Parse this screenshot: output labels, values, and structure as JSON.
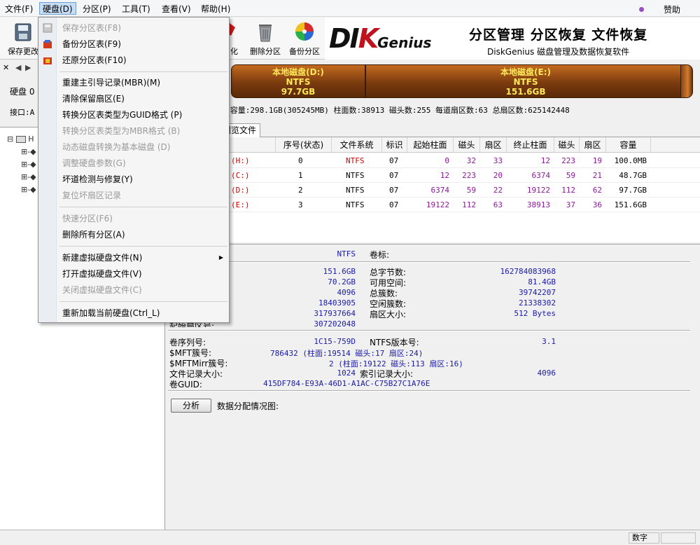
{
  "menubar": {
    "items": [
      "文件(F)",
      "硬盘(D)",
      "分区(P)",
      "工具(T)",
      "查看(V)",
      "帮助(H)"
    ],
    "sponsor": "赞助"
  },
  "toolbar": {
    "save_label": "保存更改",
    "format_label": "化",
    "delete_label": "删除分区",
    "backup_label": "备份分区"
  },
  "banner": {
    "logo_pre": "DI",
    "logo_k": "K",
    "logo_gen": "Genius",
    "tagline": "分区管理 分区恢复 文件恢复",
    "subline": "DiskGenius 磁盘管理及数据恢复软件"
  },
  "left": {
    "disk_label": "硬盘 0",
    "iface_label": "接口:A",
    "tree_root": "H"
  },
  "diskmap": {
    "d": {
      "name": "本地磁盘(D:)",
      "fs": "NTFS",
      "size": "97.7GB"
    },
    "e": {
      "name": "本地磁盘(E:)",
      "fs": "NTFS",
      "size": "151.6GB"
    }
  },
  "infoline": "PCN40Y1YFBBS6  容量:298.1GB(305245MB)  柱面数:38913  磁头数:255  每道扇区数:63  总扇区数:625142448",
  "tabs": {
    "browse": "浏览文件"
  },
  "table": {
    "headers": [
      "序号(状态)",
      "文件系统",
      "标识",
      "起始柱面",
      "磁头",
      "扇区",
      "终止柱面",
      "磁头",
      "扇区",
      "容量"
    ],
    "rows": [
      {
        "vol": "(H:)",
        "idx": "0",
        "fs": "NTFS",
        "id": "07",
        "sc": "0",
        "sh": "32",
        "ss": "33",
        "ec": "12",
        "eh": "223",
        "es": "19",
        "cap": "100.0MB"
      },
      {
        "vol": "(C:)",
        "idx": "1",
        "fs": "NTFS",
        "id": "07",
        "sc": "12",
        "sh": "223",
        "ss": "20",
        "ec": "6374",
        "eh": "59",
        "es": "21",
        "cap": "48.7GB"
      },
      {
        "vol": "(D:)",
        "idx": "2",
        "fs": "NTFS",
        "id": "07",
        "sc": "6374",
        "sh": "59",
        "ss": "22",
        "ec": "19122",
        "eh": "112",
        "es": "62",
        "cap": "97.7GB"
      },
      {
        "vol": "(E:)",
        "idx": "3",
        "fs": "NTFS",
        "id": "07",
        "sc": "19122",
        "sh": "112",
        "ss": "63",
        "ec": "38913",
        "eh": "37",
        "es": "36",
        "cap": "151.6GB"
      }
    ]
  },
  "details": {
    "fs_value": "NTFS",
    "volume_label": "卷标:",
    "left_values": [
      "151.6GB",
      "70.2GB",
      "4096",
      "18403905",
      "317937664",
      "307202048"
    ],
    "right_labels": [
      "总字节数:",
      "可用空间:",
      "总簇数:",
      "空闲簇数:",
      "扇区大小:"
    ],
    "right_values": [
      "162784083968",
      "81.4GB",
      "39742207",
      "21338302",
      "512 Bytes"
    ],
    "partial_label": "起始扇区号:",
    "serial_label": "卷序列号:",
    "serial_value": "1C15-759D",
    "ntfs_ver_label": "NTFS版本号:",
    "ntfs_ver_value": "3.1",
    "mft_label": "$MFT簇号:",
    "mft_value": "786432 (柱面:19514 磁头:17 扇区:24)",
    "mftmirr_label": "$MFTMirr簇号:",
    "mftmirr_value": "2 (柱面:19122 磁头:113 扇区:16)",
    "rec_size_label": "文件记录大小:",
    "rec_size_value": "1024",
    "idx_size_label": "索引记录大小:",
    "idx_size_value": "4096",
    "guid_label": "卷GUID:",
    "guid_value": "415DF784-E93A-46D1-A1AC-C75B27C1A76E",
    "analyze_button": "分析",
    "distribution_label": "数据分配情况图:"
  },
  "status": {
    "numlock": "数字"
  },
  "dropdown": {
    "items": [
      {
        "label": "保存分区表(F8)",
        "disabled": true
      },
      {
        "label": "备份分区表(F9)",
        "disabled": false
      },
      {
        "label": "还原分区表(F10)",
        "disabled": false
      },
      {
        "label": "重建主引导记录(MBR)(M)",
        "disabled": false
      },
      {
        "label": "清除保留扇区(E)",
        "disabled": false
      },
      {
        "label": "转换分区表类型为GUID格式 (P)",
        "disabled": false
      },
      {
        "label": "转换分区表类型为MBR格式 (B)",
        "disabled": true
      },
      {
        "label": "动态磁盘转换为基本磁盘 (D)",
        "disabled": true
      },
      {
        "label": "调整硬盘参数(G)",
        "disabled": true
      },
      {
        "label": "坏道检测与修复(Y)",
        "disabled": false
      },
      {
        "label": "复位坏扇区记录",
        "disabled": true
      },
      {
        "label": "快速分区(F6)",
        "disabled": true
      },
      {
        "label": "删除所有分区(A)",
        "disabled": false
      },
      {
        "label": "新建虚拟硬盘文件(N)",
        "disabled": false
      },
      {
        "label": "打开虚拟硬盘文件(V)",
        "disabled": false
      },
      {
        "label": "关闭虚拟硬盘文件(C)",
        "disabled": true
      },
      {
        "label": "重新加载当前硬盘(Ctrl_L)",
        "disabled": false
      }
    ]
  },
  "colors": {
    "accent_menu": "#c7ddf3",
    "disk_bar": "#8a4615",
    "bar_text": "#ffe85a",
    "table_red": "#d40000",
    "table_purple": "#8a1a9a",
    "detail_blue": "#1a1aa8"
  }
}
